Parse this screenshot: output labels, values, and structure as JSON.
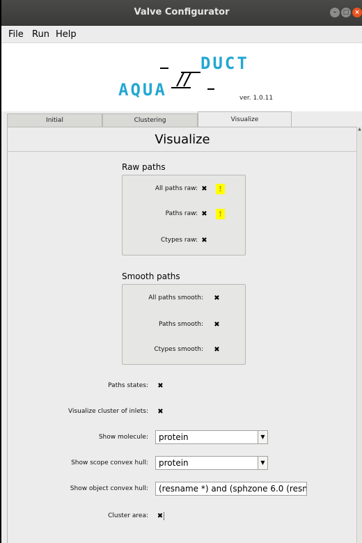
{
  "window": {
    "title": "Valve Configurator"
  },
  "menu": [
    "File",
    "Run",
    "Help"
  ],
  "logo": {
    "aqua": "AQUA",
    "duct": "DUCT",
    "version": "ver. 1.0.11"
  },
  "tabs": [
    {
      "label": "Initial",
      "active": false
    },
    {
      "label": "Clustering",
      "active": false
    },
    {
      "label": "Visualize",
      "active": true
    }
  ],
  "section_title": "Visualize",
  "raw_paths": {
    "title": "Raw paths",
    "items": [
      {
        "label": "All paths raw:",
        "checked": true,
        "warning": true,
        "warning_text": "!"
      },
      {
        "label": "Paths raw:",
        "checked": true,
        "warning": true,
        "warning_text": "!"
      },
      {
        "label": "Ctypes raw:",
        "checked": true,
        "warning": false
      }
    ]
  },
  "smooth_paths": {
    "title": "Smooth paths",
    "items": [
      {
        "label": "All paths smooth:",
        "checked": true
      },
      {
        "label": "Paths smooth:",
        "checked": true
      },
      {
        "label": "Ctypes smooth:",
        "checked": true
      }
    ]
  },
  "options": {
    "paths_states": {
      "label": "Paths states:",
      "checked": true
    },
    "visualize_cluster_inlets": {
      "label": "Visualize cluster of inlets:",
      "checked": true
    },
    "show_molecule": {
      "label": "Show molecule:",
      "value": "protein"
    },
    "show_scope_hull": {
      "label": "Show scope convex hull:",
      "value": "protein"
    },
    "show_object_hull": {
      "label": "Show object convex hull:",
      "value": "(resname *) and (sphzone 6.0 (resnu"
    },
    "cluster_area": {
      "label": "Cluster area:",
      "checked": true
    }
  },
  "check_mark": "✖",
  "colors": {
    "accent": "#22a7d3",
    "titlebar": "#3c3c3a",
    "warning": "#ffff00"
  }
}
